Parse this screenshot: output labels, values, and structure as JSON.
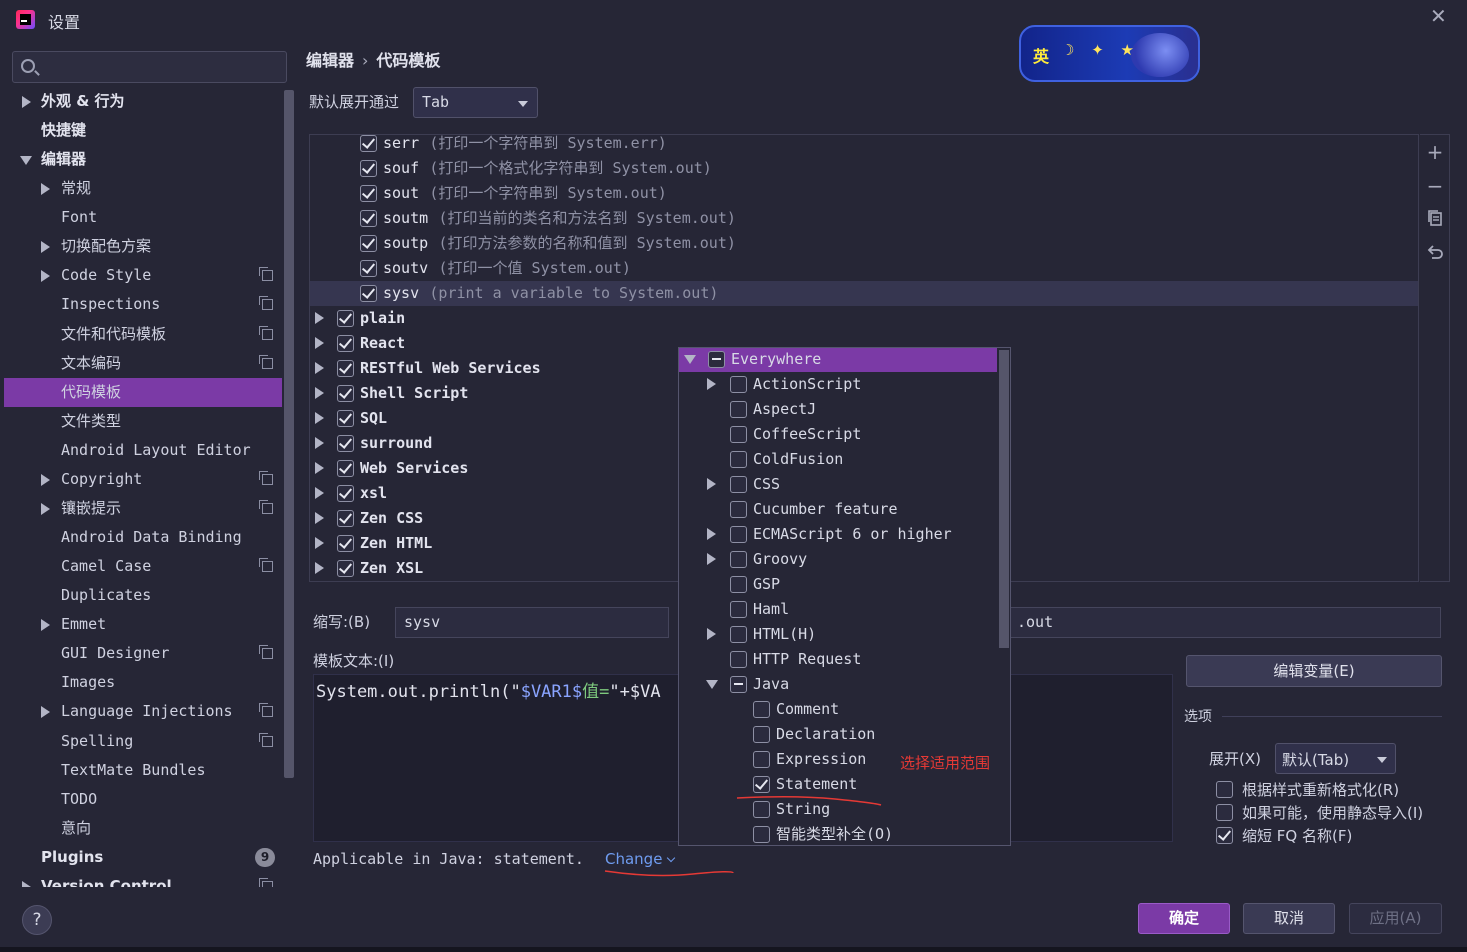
{
  "window": {
    "title": "设置"
  },
  "search": {
    "placeholder": ""
  },
  "sidebar": {
    "items": [
      {
        "label": "外观 & 行为",
        "bold": true,
        "indent": 0,
        "arrow": "right",
        "copy": false
      },
      {
        "label": "快捷键",
        "bold": true,
        "indent": 0,
        "arrow": "",
        "copy": false
      },
      {
        "label": "编辑器",
        "bold": true,
        "indent": 0,
        "arrow": "down",
        "copy": false
      },
      {
        "label": "常规",
        "bold": false,
        "indent": 1,
        "arrow": "right",
        "copy": false
      },
      {
        "label": "Font",
        "bold": false,
        "indent": 1,
        "arrow": "",
        "copy": false
      },
      {
        "label": "切换配色方案",
        "bold": false,
        "indent": 1,
        "arrow": "right",
        "copy": false
      },
      {
        "label": "Code Style",
        "bold": false,
        "indent": 1,
        "arrow": "right",
        "copy": true
      },
      {
        "label": "Inspections",
        "bold": false,
        "indent": 1,
        "arrow": "",
        "copy": true
      },
      {
        "label": "文件和代码模板",
        "bold": false,
        "indent": 1,
        "arrow": "",
        "copy": true
      },
      {
        "label": "文本编码",
        "bold": false,
        "indent": 1,
        "arrow": "",
        "copy": true
      },
      {
        "label": "代码模板",
        "bold": false,
        "indent": 1,
        "arrow": "",
        "copy": false,
        "selected": true
      },
      {
        "label": "文件类型",
        "bold": false,
        "indent": 1,
        "arrow": "",
        "copy": false
      },
      {
        "label": "Android Layout Editor",
        "bold": false,
        "indent": 1,
        "arrow": "",
        "copy": false
      },
      {
        "label": "Copyright",
        "bold": false,
        "indent": 1,
        "arrow": "right",
        "copy": true
      },
      {
        "label": "镶嵌提示",
        "bold": false,
        "indent": 1,
        "arrow": "right",
        "copy": true
      },
      {
        "label": "Android Data Binding",
        "bold": false,
        "indent": 1,
        "arrow": "",
        "copy": false
      },
      {
        "label": "Camel Case",
        "bold": false,
        "indent": 1,
        "arrow": "",
        "copy": true
      },
      {
        "label": "Duplicates",
        "bold": false,
        "indent": 1,
        "arrow": "",
        "copy": false
      },
      {
        "label": "Emmet",
        "bold": false,
        "indent": 1,
        "arrow": "right",
        "copy": false
      },
      {
        "label": "GUI Designer",
        "bold": false,
        "indent": 1,
        "arrow": "",
        "copy": true
      },
      {
        "label": "Images",
        "bold": false,
        "indent": 1,
        "arrow": "",
        "copy": false
      },
      {
        "label": "Language Injections",
        "bold": false,
        "indent": 1,
        "arrow": "right",
        "copy": true
      },
      {
        "label": "Spelling",
        "bold": false,
        "indent": 1,
        "arrow": "",
        "copy": true
      },
      {
        "label": "TextMate Bundles",
        "bold": false,
        "indent": 1,
        "arrow": "",
        "copy": false
      },
      {
        "label": "TODO",
        "bold": false,
        "indent": 1,
        "arrow": "",
        "copy": false
      },
      {
        "label": "意向",
        "bold": false,
        "indent": 1,
        "arrow": "",
        "copy": false
      },
      {
        "label": "Plugins",
        "bold": true,
        "indent": 0,
        "arrow": "",
        "copy": false,
        "badge": "9"
      },
      {
        "label": "Version Control",
        "bold": true,
        "indent": 0,
        "arrow": "right",
        "copy": true
      }
    ]
  },
  "breadcrumb": {
    "parent": "编辑器",
    "separator": "›",
    "current": "代码模板"
  },
  "ime_badge": {
    "text": "英"
  },
  "expand_via": {
    "label": "默认展开通过",
    "value": "Tab"
  },
  "templates": {
    "children": [
      {
        "key": "serr",
        "desc": "(打印一个字符串到 System.err)",
        "checked": true
      },
      {
        "key": "souf",
        "desc": "(打印一个格式化字符串到 System.out)",
        "checked": true
      },
      {
        "key": "sout",
        "desc": "(打印一个字符串到 System.out)",
        "checked": true
      },
      {
        "key": "soutm",
        "desc": "(打印当前的类名和方法名到 System.out)",
        "checked": true
      },
      {
        "key": "soutp",
        "desc": "(打印方法参数的名称和值到 System.out)",
        "checked": true
      },
      {
        "key": "soutv",
        "desc": "(打印一个值 System.out)",
        "checked": true
      },
      {
        "key": "sysv",
        "desc": "(print a variable to System.out)",
        "checked": true,
        "selected": true
      }
    ],
    "groups": [
      {
        "name": "plain",
        "checked": true
      },
      {
        "name": "React",
        "checked": true
      },
      {
        "name": "RESTful Web Services",
        "checked": true
      },
      {
        "name": "Shell Script",
        "checked": true
      },
      {
        "name": "SQL",
        "checked": true
      },
      {
        "name": "surround",
        "checked": true
      },
      {
        "name": "Web Services",
        "checked": true
      },
      {
        "name": "xsl",
        "checked": true
      },
      {
        "name": "Zen CSS",
        "checked": true
      },
      {
        "name": "Zen HTML",
        "checked": true
      },
      {
        "name": "Zen XSL",
        "checked": true
      }
    ]
  },
  "toolbar": {
    "add": "+",
    "remove": "−"
  },
  "abbreviation": {
    "label": "缩写:(B)",
    "value": "sysv"
  },
  "description": {
    "value": ".out"
  },
  "template_text": {
    "label": "模板文本:(I)",
    "code_prefix": "System.out.println(\"",
    "code_var1": "$VAR1$",
    "code_str": "值=",
    "code_suffix": "\"+$VA"
  },
  "applicable": {
    "text": "Applicable in Java: statement.",
    "change": "Change"
  },
  "edit_variables": "编辑变量(E)",
  "options": {
    "label": "选项",
    "expand_label": "展开(X)",
    "expand_value": "默认(Tab)",
    "reformat": {
      "label": "根据样式重新格式化(R)",
      "checked": false
    },
    "static_import": {
      "label": "如果可能，使用静态导入(I)",
      "checked": false
    },
    "shorten_fq": {
      "label": "缩短 FQ 名称(F)",
      "checked": true
    }
  },
  "context_popup": {
    "items": [
      {
        "label": "Everywhere",
        "indent": 0,
        "arrow": "down",
        "state": "dash",
        "selected": true
      },
      {
        "label": "ActionScript",
        "indent": 1,
        "arrow": "right",
        "state": "off"
      },
      {
        "label": "AspectJ",
        "indent": 1,
        "arrow": "",
        "state": "off"
      },
      {
        "label": "CoffeeScript",
        "indent": 1,
        "arrow": "",
        "state": "off"
      },
      {
        "label": "ColdFusion",
        "indent": 1,
        "arrow": "",
        "state": "off"
      },
      {
        "label": "CSS",
        "indent": 1,
        "arrow": "right",
        "state": "off"
      },
      {
        "label": "Cucumber feature",
        "indent": 1,
        "arrow": "",
        "state": "off"
      },
      {
        "label": "ECMAScript 6 or higher",
        "indent": 1,
        "arrow": "right",
        "state": "off"
      },
      {
        "label": "Groovy",
        "indent": 1,
        "arrow": "right",
        "state": "off"
      },
      {
        "label": "GSP",
        "indent": 1,
        "arrow": "",
        "state": "off"
      },
      {
        "label": "Haml",
        "indent": 1,
        "arrow": "",
        "state": "off"
      },
      {
        "label": "HTML(H)",
        "indent": 1,
        "arrow": "right",
        "state": "off"
      },
      {
        "label": "HTTP Request",
        "indent": 1,
        "arrow": "",
        "state": "off"
      },
      {
        "label": "Java",
        "indent": 1,
        "arrow": "down",
        "state": "dash"
      },
      {
        "label": "Comment",
        "indent": 2,
        "arrow": "",
        "state": "off"
      },
      {
        "label": "Declaration",
        "indent": 2,
        "arrow": "",
        "state": "off"
      },
      {
        "label": "Expression",
        "indent": 2,
        "arrow": "",
        "state": "off"
      },
      {
        "label": "Statement",
        "indent": 2,
        "arrow": "",
        "state": "on"
      },
      {
        "label": "String",
        "indent": 2,
        "arrow": "",
        "state": "off"
      },
      {
        "label": "智能类型补全(O)",
        "indent": 2,
        "arrow": "",
        "state": "off"
      }
    ]
  },
  "annotation": {
    "text": "选择适用范围",
    "color": "#e53935"
  },
  "buttons": {
    "help": "?",
    "ok": "确定",
    "cancel": "取消",
    "apply": "应用(A)"
  },
  "colors": {
    "accent": "#7b3aa6",
    "link": "#6f9cf0"
  }
}
